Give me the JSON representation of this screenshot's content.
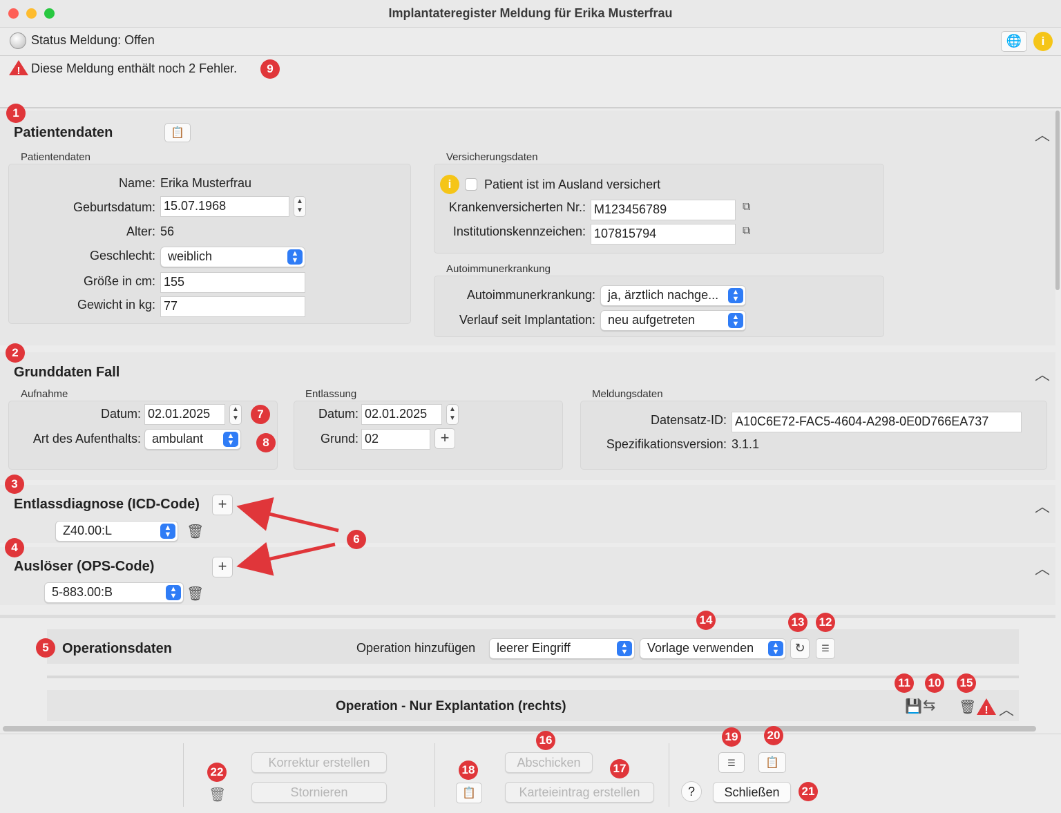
{
  "window": {
    "title": "Implantateregister Meldung für Erika Musterfrau"
  },
  "status": {
    "label": "Status Meldung: Offen",
    "error_text": "Diese Meldung enthält noch 2 Fehler."
  },
  "patient": {
    "section_title": "Patientendaten",
    "group_title": "Patientendaten",
    "name_label": "Name:",
    "name_value": "Erika Musterfrau",
    "dob_label": "Geburtsdatum:",
    "dob_value": "15.07.1968",
    "age_label": "Alter:",
    "age_value": "56",
    "sex_label": "Geschlecht:",
    "sex_value": "weiblich",
    "height_label": "Größe in cm:",
    "height_value": "155",
    "weight_label": "Gewicht in kg:",
    "weight_value": "77"
  },
  "insurance": {
    "group_title": "Versicherungsdaten",
    "abroad_label": "Patient ist im Ausland versichert",
    "kvnr_label": "Krankenversicherten Nr.:",
    "kvnr_value": "M123456789",
    "ik_label": "Institutionskennzeichen:",
    "ik_value": "107815794"
  },
  "autoimmune": {
    "group_title": "Autoimmunerkrankung",
    "disease_label": "Autoimmunerkrankung:",
    "disease_value": "ja, ärztlich nachge...",
    "course_label": "Verlauf seit Implantation:",
    "course_value": "neu aufgetreten"
  },
  "case": {
    "section_title": "Grunddaten Fall",
    "admission_title": "Aufnahme",
    "admission_date_label": "Datum:",
    "admission_date": "02.01.2025",
    "stay_label": "Art des Aufenthalts:",
    "stay_value": "ambulant",
    "discharge_title": "Entlassung",
    "discharge_date_label": "Datum:",
    "discharge_date": "02.01.2025",
    "reason_label": "Grund:",
    "reason_value": "02",
    "report_title": "Meldungsdaten",
    "record_id_label": "Datensatz-ID:",
    "record_id": "A10C6E72-FAC5-4604-A298-0E0D766EA737",
    "spec_label": "Spezifikationsversion:",
    "spec_value": "3.1.1"
  },
  "diagnosis": {
    "section_title": "Entlassdiagnose (ICD-Code)",
    "code": "Z40.00:L"
  },
  "trigger": {
    "section_title": "Auslöser (OPS-Code)",
    "code": "5-883.00:B"
  },
  "operations": {
    "section_title": "Operationsdaten",
    "add_label": "Operation hinzufügen",
    "type_value": "leerer Eingriff",
    "template_value": "Vorlage verwenden",
    "op_title": "Operation -  Nur Explantation (rechts)"
  },
  "footer": {
    "correction": "Korrektur erstellen",
    "cancel_report": "Stornieren",
    "send": "Abschicken",
    "record_entry": "Karteieintrag erstellen",
    "help": "?",
    "close": "Schließen"
  },
  "badges": [
    "1",
    "2",
    "3",
    "4",
    "5",
    "6",
    "7",
    "8",
    "9",
    "10",
    "11",
    "12",
    "13",
    "14",
    "15",
    "16",
    "17",
    "18",
    "19",
    "20",
    "21",
    "22"
  ],
  "colors": {
    "badge": "#e0363a",
    "accent": "#2f7cf6",
    "info": "#f5c518",
    "warning": "#e0363a"
  }
}
